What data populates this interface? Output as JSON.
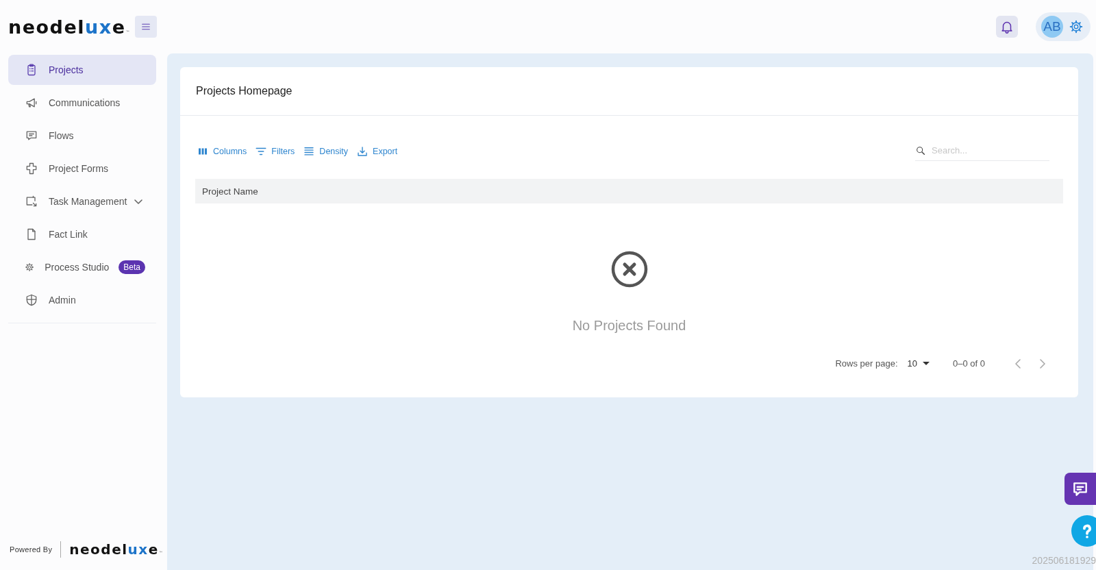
{
  "logo": {
    "parts": [
      {
        "text": "neodel",
        "accent": false
      },
      {
        "text": "ux",
        "accent": true
      },
      {
        "text": "e",
        "accent": false
      }
    ],
    "mark": "™"
  },
  "sidebar": {
    "items": [
      {
        "label": "Projects",
        "selected": true
      },
      {
        "label": "Communications",
        "selected": false
      },
      {
        "label": "Flows",
        "selected": false
      },
      {
        "label": "Project Forms",
        "selected": false
      },
      {
        "label": "Task Management",
        "selected": false,
        "expandable": true
      },
      {
        "label": "Fact Link",
        "selected": false
      },
      {
        "label": "Process Studio",
        "selected": false,
        "badge": "Beta"
      },
      {
        "label": "Admin",
        "selected": false
      }
    ],
    "powered_by": "Powered By",
    "footer_logo": {
      "parts": [
        {
          "text": "neodel",
          "accent": false
        },
        {
          "text": "ux",
          "accent": true
        },
        {
          "text": "e",
          "accent": false
        }
      ],
      "mark": "™"
    }
  },
  "header": {
    "avatar": "AB"
  },
  "card": {
    "title": "Projects Homepage",
    "toolbar": [
      {
        "label": "Columns"
      },
      {
        "label": "Filters"
      },
      {
        "label": "Density"
      },
      {
        "label": "Export"
      }
    ],
    "search": {
      "placeholder": "Search..."
    },
    "table": {
      "columns": [
        "Project Name"
      ]
    },
    "empty_message": "No Projects Found",
    "pagination": {
      "rows_label": "Rows per page:",
      "rows_value": "10",
      "range": "0–0 of 0"
    }
  },
  "version": "202506181929"
}
